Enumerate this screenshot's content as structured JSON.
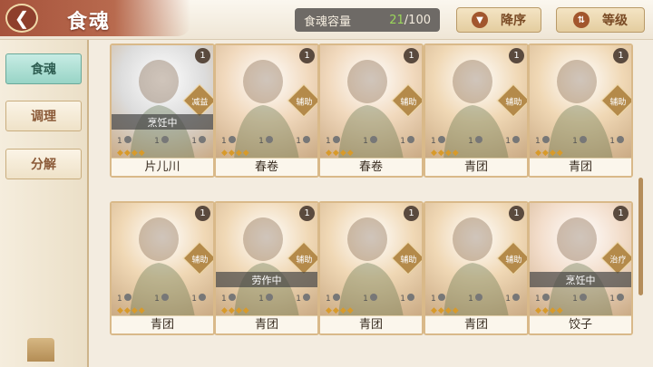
{
  "header": {
    "title": "食魂",
    "capacity_label": "食魂容量",
    "capacity_current": "21",
    "capacity_max": "/100",
    "sort_label": "降序",
    "level_label": "等级"
  },
  "sidebar": {
    "tabs": [
      {
        "label": "食魂"
      },
      {
        "label": "调理"
      },
      {
        "label": "分解"
      }
    ]
  },
  "cards": [
    {
      "name": "片儿川",
      "level": "1",
      "role": "减益",
      "status": "烹饪中",
      "stats": [
        "1",
        "1",
        "1"
      ],
      "theme": "#dcdcdc"
    },
    {
      "name": "春卷",
      "level": "1",
      "role": "辅助",
      "status": "",
      "stats": [
        "1",
        "1",
        "1"
      ],
      "theme": "#f1d9bd"
    },
    {
      "name": "春卷",
      "level": "1",
      "role": "辅助",
      "status": "",
      "stats": [
        "1",
        "1",
        "1"
      ],
      "theme": "#f1d9bd"
    },
    {
      "name": "青团",
      "level": "1",
      "role": "辅助",
      "status": "",
      "stats": [
        "1",
        "1",
        "1"
      ],
      "theme": "#f0d8b5"
    },
    {
      "name": "青团",
      "level": "1",
      "role": "辅助",
      "status": "",
      "stats": [
        "1",
        "1",
        "1"
      ],
      "theme": "#f0d8b5"
    },
    {
      "name": "青团",
      "level": "1",
      "role": "辅助",
      "status": "",
      "stats": [
        "1",
        "1",
        "1"
      ],
      "theme": "#f0d8b5"
    },
    {
      "name": "青团",
      "level": "1",
      "role": "辅助",
      "status": "劳作中",
      "stats": [
        "1",
        "1",
        "1"
      ],
      "theme": "#f0d8b5"
    },
    {
      "name": "青团",
      "level": "1",
      "role": "辅助",
      "status": "",
      "stats": [
        "1",
        "1",
        "1"
      ],
      "theme": "#f0d8b5"
    },
    {
      "name": "青团",
      "level": "1",
      "role": "辅助",
      "status": "",
      "stats": [
        "1",
        "1",
        "1"
      ],
      "theme": "#f0d8b5"
    },
    {
      "name": "饺子",
      "level": "1",
      "role": "治疗",
      "status": "烹饪中",
      "stats": [
        "1",
        "1",
        "1"
      ],
      "theme": "#f2dcc9"
    }
  ],
  "colors": {
    "accent": "#a6533c",
    "active_tab": "#98d4c6",
    "card_border": "#d9b989",
    "capacity_current": "#9bd65a"
  },
  "icons": {
    "back": "back-arrow-icon",
    "sort": "sort-down-icon",
    "level": "sort-level-icon"
  }
}
